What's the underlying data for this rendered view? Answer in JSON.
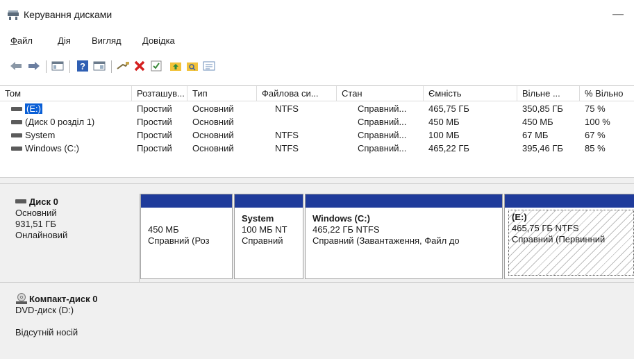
{
  "window": {
    "title": "Керування дисками",
    "minimize": "—"
  },
  "menu": {
    "items": [
      {
        "u": "Ф",
        "rest": "айл"
      },
      {
        "u": "Д",
        "rest": "ія"
      },
      {
        "u": "В",
        "rest": "игляд",
        "pre": ""
      },
      {
        "u": "Д",
        "rest": "овідка"
      }
    ],
    "labels": [
      "Файл",
      "Дія",
      "Вигляд",
      "Довідка"
    ]
  },
  "toolbar": {
    "icons": [
      "back-arrow-icon",
      "forward-arrow-icon",
      "console-tree-icon",
      "help-icon",
      "properties-pane-icon",
      "connect-icon",
      "delete-icon",
      "check-icon",
      "folder-up-icon",
      "search-folder-icon",
      "settings-list-icon"
    ]
  },
  "volume_table": {
    "headers": [
      "Том",
      "Розташув...",
      "Тип",
      "Файлова си...",
      "Стан",
      "Ємність",
      "Вільне ...",
      "% Вільно"
    ],
    "rows": [
      [
        "(E:)",
        "Простий",
        "Основний",
        "NTFS",
        "Справний...",
        "465,75 ГБ",
        "350,85 ГБ",
        "75 %"
      ],
      [
        "(Диск 0 розділ 1)",
        "Простий",
        "Основний",
        "",
        "Справний...",
        "450 МБ",
        "450 МБ",
        "100 %"
      ],
      [
        "System",
        "Простий",
        "Основний",
        "NTFS",
        "Справний...",
        "100 МБ",
        "67 МБ",
        "67 %"
      ],
      [
        "Windows (C:)",
        "Простий",
        "Основний",
        "NTFS",
        "Справний...",
        "465,22 ГБ",
        "395,46 ГБ",
        "85 %"
      ]
    ]
  },
  "disk0": {
    "name": "Диск 0",
    "type": "Основний",
    "size": "931,51 ГБ",
    "status": "Онлайновий",
    "partitions": [
      {
        "name": "",
        "size": "450 МБ",
        "status": "Справний (Роз"
      },
      {
        "name": "System",
        "size": "100 МБ NT",
        "status": "Справний"
      },
      {
        "name": "Windows  (C:)",
        "size": "465,22 ГБ NTFS",
        "status": "Справний (Завантаження, Файл до"
      },
      {
        "name": "(E:)",
        "size": "465,75 ГБ NTFS",
        "status": "Справний (Первинний"
      }
    ]
  },
  "cdrom0": {
    "name": "Компакт-диск 0",
    "type": "DVD-диск (D:)",
    "status": "Відсутній носій"
  },
  "colors": {
    "partition_bar": "#1f3b9b",
    "selection": "#0a5fd6",
    "pane_bg": "#f0f0f0"
  }
}
